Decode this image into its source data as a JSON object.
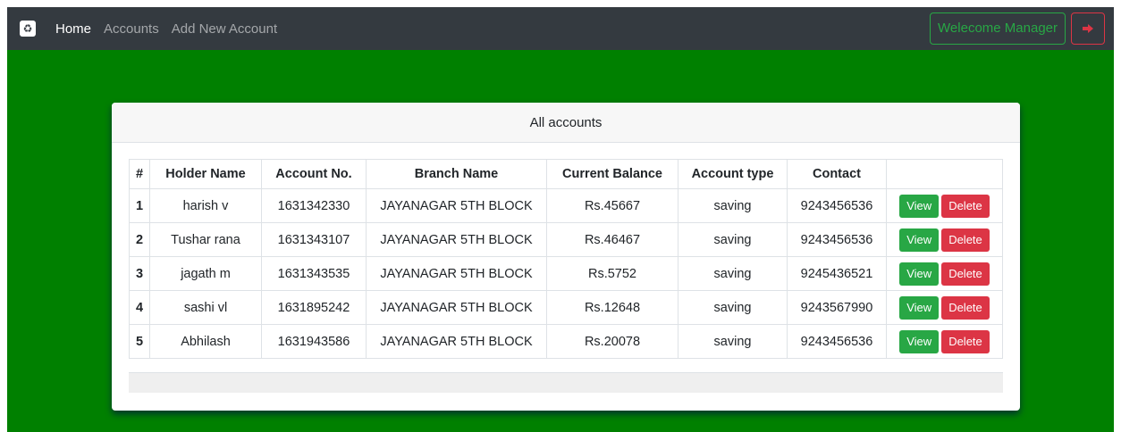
{
  "navbar": {
    "links": [
      {
        "label": "Home",
        "active": true
      },
      {
        "label": "Accounts",
        "active": false
      },
      {
        "label": "Add New Account",
        "active": false
      }
    ],
    "welcome_label": "Welecome Manager",
    "logout_icon": "sign-out-icon"
  },
  "card": {
    "title": "All accounts"
  },
  "table": {
    "headers": [
      "#",
      "Holder Name",
      "Account No.",
      "Branch Name",
      "Current Balance",
      "Account type",
      "Contact",
      ""
    ],
    "rows": [
      {
        "idx": "1",
        "name": "harish v",
        "account_no": "1631342330",
        "branch": "JAYANAGAR 5TH BLOCK",
        "balance": "Rs.45667",
        "type": "saving",
        "contact": "9243456536"
      },
      {
        "idx": "2",
        "name": "Tushar rana",
        "account_no": "1631343107",
        "branch": "JAYANAGAR 5TH BLOCK",
        "balance": "Rs.46467",
        "type": "saving",
        "contact": "9243456536"
      },
      {
        "idx": "3",
        "name": "jagath m",
        "account_no": "1631343535",
        "branch": "JAYANAGAR 5TH BLOCK",
        "balance": "Rs.5752",
        "type": "saving",
        "contact": "9245436521"
      },
      {
        "idx": "4",
        "name": "sashi vl",
        "account_no": "1631895242",
        "branch": "JAYANAGAR 5TH BLOCK",
        "balance": "Rs.12648",
        "type": "saving",
        "contact": "9243567990"
      },
      {
        "idx": "5",
        "name": "Abhilash",
        "account_no": "1631943586",
        "branch": "JAYANAGAR 5TH BLOCK",
        "balance": "Rs.20078",
        "type": "saving",
        "contact": "9243456536"
      }
    ],
    "view_label": "View",
    "delete_label": "Delete"
  },
  "colors": {
    "background": "#008000",
    "navbar": "#343a40",
    "success": "#28a745",
    "danger": "#dc3545"
  }
}
